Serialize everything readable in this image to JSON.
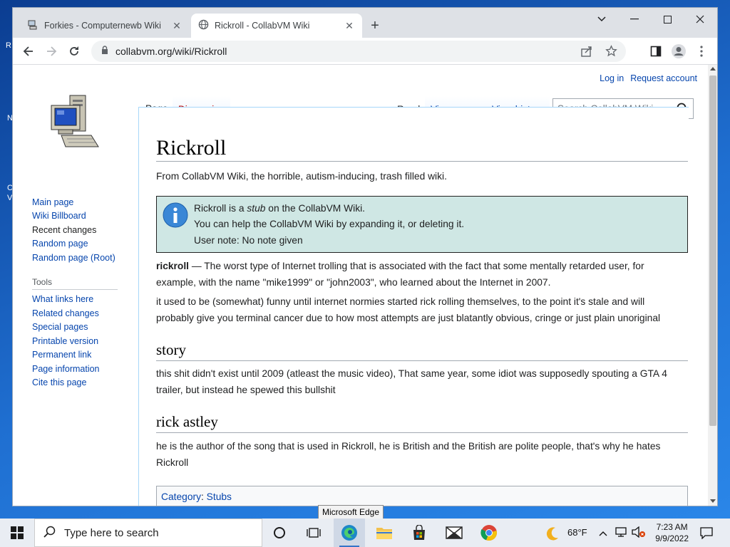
{
  "desktop": {
    "edge_chars": [
      "R",
      "N",
      "C",
      "V"
    ]
  },
  "browser": {
    "tabs": [
      {
        "title": "Forkies - Computernewb Wiki",
        "icon": "wiki-favicon-icon",
        "active": false
      },
      {
        "title": "Rickroll - CollabVM Wiki",
        "icon": "globe-icon",
        "active": true
      }
    ],
    "new_tab": "+",
    "url": "collabvm.org/wiki/Rickroll"
  },
  "wiki": {
    "personal": {
      "login": "Log in",
      "request": "Request account"
    },
    "tabs": {
      "page": "Page",
      "discussion": "Discussion",
      "read": "Read",
      "view_source": "View source",
      "view_history": "View history"
    },
    "search_placeholder": "Search CollabVM Wiki",
    "nav": [
      "Main page",
      "Wiki Billboard",
      "Recent changes",
      "Random page",
      "Random page (Root)"
    ],
    "tools_heading": "Tools",
    "tools": [
      "What links here",
      "Related changes",
      "Special pages",
      "Printable version",
      "Permanent link",
      "Page information",
      "Cite this page"
    ],
    "title": "Rickroll",
    "tagline": "From CollabVM Wiki, the horrible, autism-inducing, trash filled wiki.",
    "stub": {
      "line1_pre": "Rickroll is a ",
      "line1_em": "stub",
      "line1_post": " on the CollabVM Wiki.",
      "line2": "You can help the CollabVM Wiki by expanding it, or deleting it.",
      "line3": "User note: No note given"
    },
    "intro_bold": "rickroll",
    "intro_rest": " — The worst type of Internet trolling that is associated with the fact that some mentally retarded user, for example, with the name \"mike1999\" or \"john2003\", who learned about the Internet in 2007.",
    "para2": "it used to be (somewhat) funny until internet normies started rick rolling themselves, to the point it's stale and will probably give you terminal cancer due to how most attempts are just blatantly obvious, cringe or just plain unoriginal",
    "h_story": "story",
    "story": "this shit didn't exist until 2009 (atleast the music video), That same year, some idiot was supposedly spouting a GTA 4 trailer, but instead he spewed this bullshit",
    "h_rick": "rick astley",
    "rick": "he is the author of the song that is used in Rickroll, he is British and the British are polite people, that's why he hates Rickroll",
    "category_label": "Category",
    "category_value": "Stubs"
  },
  "tooltip": "Microsoft Edge",
  "taskbar": {
    "search_placeholder": "Type here to search",
    "weather": "68°F",
    "time": "7:23 AM",
    "date": "9/9/2022"
  }
}
